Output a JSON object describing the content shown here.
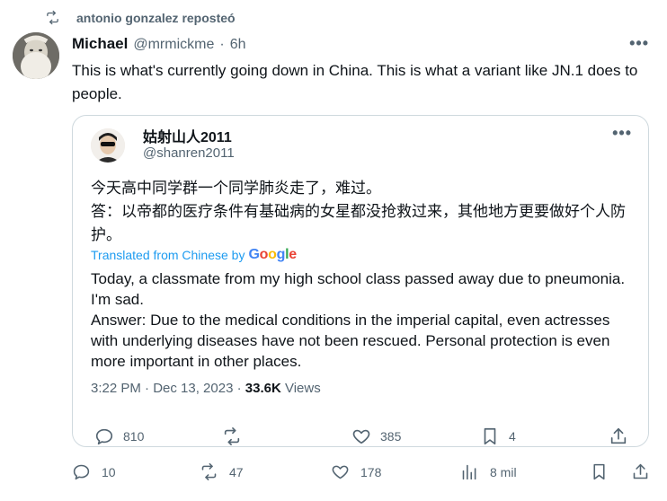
{
  "repost": {
    "text": "antonio gonzalez reposteó"
  },
  "tweet": {
    "name": "Michael",
    "handle": "@mrmickme",
    "separator": "·",
    "age": "6h",
    "more": "•••",
    "text": "This is what's currently going down in China. This is what a variant like JN.1 does to people."
  },
  "quote": {
    "name": "姑射山人2011",
    "handle": "@shanren2011",
    "more": "•••",
    "text_zh": "今天高中同学群一个同学肺炎走了，难过。\n答：以帝都的医疗条件有基础病的女星都没抢救过来，其他地方更要做好个人防护。",
    "translated_label": "Translated from Chinese by",
    "google": [
      "G",
      "o",
      "o",
      "g",
      "l",
      "e"
    ],
    "text_en": "Today, a classmate from my high school class passed away due to pneumonia. I'm sad.\nAnswer: Due to the medical conditions in the imperial capital, even actresses with underlying diseases have not been rescued. Personal protection is even more important in other places.",
    "time": "3:22 PM · Dec 13, 2023 · ",
    "views_count": "33.6K",
    "views_label": " Views",
    "actions": {
      "replies": "810",
      "likes": "385",
      "bookmarks": "4"
    }
  },
  "actions": {
    "replies": "10",
    "reposts": "47",
    "likes": "178",
    "views": "8 mil"
  },
  "icons": {
    "repost": "repost-icon",
    "reply": "reply-icon",
    "like": "heart-icon",
    "bookmark": "bookmark-icon",
    "share": "share-icon",
    "views": "views-icon"
  },
  "colors": {
    "accent": "#1d9bf0",
    "muted": "#536471",
    "text": "#0f1419",
    "border": "#cfd9de"
  }
}
